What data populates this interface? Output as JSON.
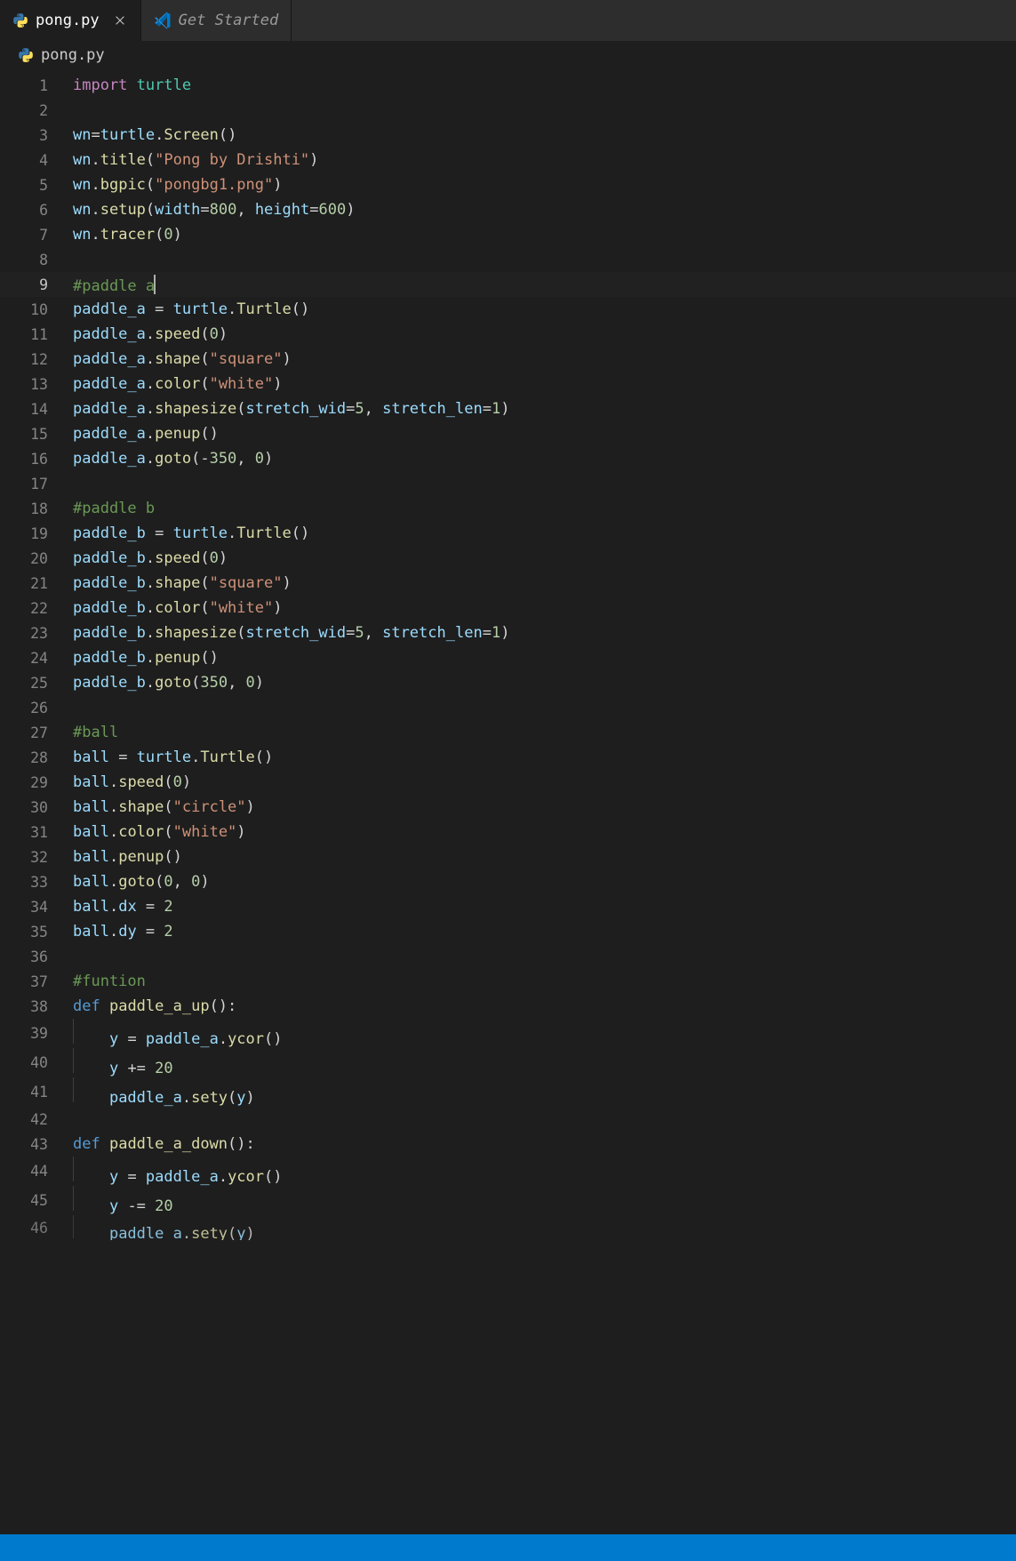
{
  "tabs": [
    {
      "icon": "python",
      "label": "pong.py",
      "active": true,
      "closeable": true
    },
    {
      "icon": "vscode",
      "label": "Get Started",
      "active": false,
      "closeable": false,
      "italic": true
    }
  ],
  "breadcrumb": {
    "icon": "python",
    "label": "pong.py"
  },
  "current_line": 9,
  "code": {
    "1": [
      {
        "c": "kw",
        "t": "import"
      },
      {
        "c": "p",
        "t": " "
      },
      {
        "c": "cls",
        "t": "turtle"
      }
    ],
    "2": [],
    "3": [
      {
        "c": "id",
        "t": "wn"
      },
      {
        "c": "p",
        "t": "="
      },
      {
        "c": "id",
        "t": "turtle"
      },
      {
        "c": "p",
        "t": "."
      },
      {
        "c": "fn",
        "t": "Screen"
      },
      {
        "c": "p",
        "t": "()"
      }
    ],
    "4": [
      {
        "c": "id",
        "t": "wn"
      },
      {
        "c": "p",
        "t": "."
      },
      {
        "c": "fn",
        "t": "title"
      },
      {
        "c": "p",
        "t": "("
      },
      {
        "c": "str",
        "t": "\"Pong by Drishti\""
      },
      {
        "c": "p",
        "t": ")"
      }
    ],
    "5": [
      {
        "c": "id",
        "t": "wn"
      },
      {
        "c": "p",
        "t": "."
      },
      {
        "c": "fn",
        "t": "bgpic"
      },
      {
        "c": "p",
        "t": "("
      },
      {
        "c": "str",
        "t": "\"pongbg1.png\""
      },
      {
        "c": "p",
        "t": ")"
      }
    ],
    "6": [
      {
        "c": "id",
        "t": "wn"
      },
      {
        "c": "p",
        "t": "."
      },
      {
        "c": "fn",
        "t": "setup"
      },
      {
        "c": "p",
        "t": "("
      },
      {
        "c": "id",
        "t": "width"
      },
      {
        "c": "p",
        "t": "="
      },
      {
        "c": "num",
        "t": "800"
      },
      {
        "c": "p",
        "t": ", "
      },
      {
        "c": "id",
        "t": "height"
      },
      {
        "c": "p",
        "t": "="
      },
      {
        "c": "num",
        "t": "600"
      },
      {
        "c": "p",
        "t": ")"
      }
    ],
    "7": [
      {
        "c": "id",
        "t": "wn"
      },
      {
        "c": "p",
        "t": "."
      },
      {
        "c": "fn",
        "t": "tracer"
      },
      {
        "c": "p",
        "t": "("
      },
      {
        "c": "num",
        "t": "0"
      },
      {
        "c": "p",
        "t": ")"
      }
    ],
    "8": [],
    "9": [
      {
        "c": "cmt",
        "t": "#paddle a"
      }
    ],
    "10": [
      {
        "c": "id",
        "t": "paddle_a"
      },
      {
        "c": "p",
        "t": " = "
      },
      {
        "c": "id",
        "t": "turtle"
      },
      {
        "c": "p",
        "t": "."
      },
      {
        "c": "fn",
        "t": "Turtle"
      },
      {
        "c": "p",
        "t": "()"
      }
    ],
    "11": [
      {
        "c": "id",
        "t": "paddle_a"
      },
      {
        "c": "p",
        "t": "."
      },
      {
        "c": "fn",
        "t": "speed"
      },
      {
        "c": "p",
        "t": "("
      },
      {
        "c": "num",
        "t": "0"
      },
      {
        "c": "p",
        "t": ")"
      }
    ],
    "12": [
      {
        "c": "id",
        "t": "paddle_a"
      },
      {
        "c": "p",
        "t": "."
      },
      {
        "c": "fn",
        "t": "shape"
      },
      {
        "c": "p",
        "t": "("
      },
      {
        "c": "str",
        "t": "\"square\""
      },
      {
        "c": "p",
        "t": ")"
      }
    ],
    "13": [
      {
        "c": "id",
        "t": "paddle_a"
      },
      {
        "c": "p",
        "t": "."
      },
      {
        "c": "fn",
        "t": "color"
      },
      {
        "c": "p",
        "t": "("
      },
      {
        "c": "str",
        "t": "\"white\""
      },
      {
        "c": "p",
        "t": ")"
      }
    ],
    "14": [
      {
        "c": "id",
        "t": "paddle_a"
      },
      {
        "c": "p",
        "t": "."
      },
      {
        "c": "fn",
        "t": "shapesize"
      },
      {
        "c": "p",
        "t": "("
      },
      {
        "c": "id",
        "t": "stretch_wid"
      },
      {
        "c": "p",
        "t": "="
      },
      {
        "c": "num",
        "t": "5"
      },
      {
        "c": "p",
        "t": ", "
      },
      {
        "c": "id",
        "t": "stretch_len"
      },
      {
        "c": "p",
        "t": "="
      },
      {
        "c": "num",
        "t": "1"
      },
      {
        "c": "p",
        "t": ")"
      }
    ],
    "15": [
      {
        "c": "id",
        "t": "paddle_a"
      },
      {
        "c": "p",
        "t": "."
      },
      {
        "c": "fn",
        "t": "penup"
      },
      {
        "c": "p",
        "t": "()"
      }
    ],
    "16": [
      {
        "c": "id",
        "t": "paddle_a"
      },
      {
        "c": "p",
        "t": "."
      },
      {
        "c": "fn",
        "t": "goto"
      },
      {
        "c": "p",
        "t": "(-"
      },
      {
        "c": "num",
        "t": "350"
      },
      {
        "c": "p",
        "t": ", "
      },
      {
        "c": "num",
        "t": "0"
      },
      {
        "c": "p",
        "t": ")"
      }
    ],
    "17": [],
    "18": [
      {
        "c": "cmt",
        "t": "#paddle b"
      }
    ],
    "19": [
      {
        "c": "id",
        "t": "paddle_b"
      },
      {
        "c": "p",
        "t": " = "
      },
      {
        "c": "id",
        "t": "turtle"
      },
      {
        "c": "p",
        "t": "."
      },
      {
        "c": "fn",
        "t": "Turtle"
      },
      {
        "c": "p",
        "t": "()"
      }
    ],
    "20": [
      {
        "c": "id",
        "t": "paddle_b"
      },
      {
        "c": "p",
        "t": "."
      },
      {
        "c": "fn",
        "t": "speed"
      },
      {
        "c": "p",
        "t": "("
      },
      {
        "c": "num",
        "t": "0"
      },
      {
        "c": "p",
        "t": ")"
      }
    ],
    "21": [
      {
        "c": "id",
        "t": "paddle_b"
      },
      {
        "c": "p",
        "t": "."
      },
      {
        "c": "fn",
        "t": "shape"
      },
      {
        "c": "p",
        "t": "("
      },
      {
        "c": "str",
        "t": "\"square\""
      },
      {
        "c": "p",
        "t": ")"
      }
    ],
    "22": [
      {
        "c": "id",
        "t": "paddle_b"
      },
      {
        "c": "p",
        "t": "."
      },
      {
        "c": "fn",
        "t": "color"
      },
      {
        "c": "p",
        "t": "("
      },
      {
        "c": "str",
        "t": "\"white\""
      },
      {
        "c": "p",
        "t": ")"
      }
    ],
    "23": [
      {
        "c": "id",
        "t": "paddle_b"
      },
      {
        "c": "p",
        "t": "."
      },
      {
        "c": "fn",
        "t": "shapesize"
      },
      {
        "c": "p",
        "t": "("
      },
      {
        "c": "id",
        "t": "stretch_wid"
      },
      {
        "c": "p",
        "t": "="
      },
      {
        "c": "num",
        "t": "5"
      },
      {
        "c": "p",
        "t": ", "
      },
      {
        "c": "id",
        "t": "stretch_len"
      },
      {
        "c": "p",
        "t": "="
      },
      {
        "c": "num",
        "t": "1"
      },
      {
        "c": "p",
        "t": ")"
      }
    ],
    "24": [
      {
        "c": "id",
        "t": "paddle_b"
      },
      {
        "c": "p",
        "t": "."
      },
      {
        "c": "fn",
        "t": "penup"
      },
      {
        "c": "p",
        "t": "()"
      }
    ],
    "25": [
      {
        "c": "id",
        "t": "paddle_b"
      },
      {
        "c": "p",
        "t": "."
      },
      {
        "c": "fn",
        "t": "goto"
      },
      {
        "c": "p",
        "t": "("
      },
      {
        "c": "num",
        "t": "350"
      },
      {
        "c": "p",
        "t": ", "
      },
      {
        "c": "num",
        "t": "0"
      },
      {
        "c": "p",
        "t": ")"
      }
    ],
    "26": [],
    "27": [
      {
        "c": "cmt",
        "t": "#ball"
      }
    ],
    "28": [
      {
        "c": "id",
        "t": "ball"
      },
      {
        "c": "p",
        "t": " = "
      },
      {
        "c": "id",
        "t": "turtle"
      },
      {
        "c": "p",
        "t": "."
      },
      {
        "c": "fn",
        "t": "Turtle"
      },
      {
        "c": "p",
        "t": "()"
      }
    ],
    "29": [
      {
        "c": "id",
        "t": "ball"
      },
      {
        "c": "p",
        "t": "."
      },
      {
        "c": "fn",
        "t": "speed"
      },
      {
        "c": "p",
        "t": "("
      },
      {
        "c": "num",
        "t": "0"
      },
      {
        "c": "p",
        "t": ")"
      }
    ],
    "30": [
      {
        "c": "id",
        "t": "ball"
      },
      {
        "c": "p",
        "t": "."
      },
      {
        "c": "fn",
        "t": "shape"
      },
      {
        "c": "p",
        "t": "("
      },
      {
        "c": "str",
        "t": "\"circle\""
      },
      {
        "c": "p",
        "t": ")"
      }
    ],
    "31": [
      {
        "c": "id",
        "t": "ball"
      },
      {
        "c": "p",
        "t": "."
      },
      {
        "c": "fn",
        "t": "color"
      },
      {
        "c": "p",
        "t": "("
      },
      {
        "c": "str",
        "t": "\"white\""
      },
      {
        "c": "p",
        "t": ")"
      }
    ],
    "32": [
      {
        "c": "id",
        "t": "ball"
      },
      {
        "c": "p",
        "t": "."
      },
      {
        "c": "fn",
        "t": "penup"
      },
      {
        "c": "p",
        "t": "()"
      }
    ],
    "33": [
      {
        "c": "id",
        "t": "ball"
      },
      {
        "c": "p",
        "t": "."
      },
      {
        "c": "fn",
        "t": "goto"
      },
      {
        "c": "p",
        "t": "("
      },
      {
        "c": "num",
        "t": "0"
      },
      {
        "c": "p",
        "t": ", "
      },
      {
        "c": "num",
        "t": "0"
      },
      {
        "c": "p",
        "t": ")"
      }
    ],
    "34": [
      {
        "c": "id",
        "t": "ball"
      },
      {
        "c": "p",
        "t": "."
      },
      {
        "c": "id",
        "t": "dx"
      },
      {
        "c": "p",
        "t": " = "
      },
      {
        "c": "num",
        "t": "2"
      }
    ],
    "35": [
      {
        "c": "id",
        "t": "ball"
      },
      {
        "c": "p",
        "t": "."
      },
      {
        "c": "id",
        "t": "dy"
      },
      {
        "c": "p",
        "t": " = "
      },
      {
        "c": "num",
        "t": "2"
      }
    ],
    "36": [],
    "37": [
      {
        "c": "cmt",
        "t": "#funtion"
      }
    ],
    "38": [
      {
        "c": "def",
        "t": "def"
      },
      {
        "c": "p",
        "t": " "
      },
      {
        "c": "fn",
        "t": "paddle_a_up"
      },
      {
        "c": "p",
        "t": "():"
      }
    ],
    "39": [
      {
        "c": "guide"
      },
      {
        "c": "p",
        "t": "    "
      },
      {
        "c": "id",
        "t": "y"
      },
      {
        "c": "p",
        "t": " = "
      },
      {
        "c": "id",
        "t": "paddle_a"
      },
      {
        "c": "p",
        "t": "."
      },
      {
        "c": "fn",
        "t": "ycor"
      },
      {
        "c": "p",
        "t": "()"
      }
    ],
    "40": [
      {
        "c": "guide"
      },
      {
        "c": "p",
        "t": "    "
      },
      {
        "c": "id",
        "t": "y"
      },
      {
        "c": "p",
        "t": " += "
      },
      {
        "c": "num",
        "t": "20"
      }
    ],
    "41": [
      {
        "c": "guide"
      },
      {
        "c": "p",
        "t": "    "
      },
      {
        "c": "id",
        "t": "paddle_a"
      },
      {
        "c": "p",
        "t": "."
      },
      {
        "c": "fn",
        "t": "sety"
      },
      {
        "c": "p",
        "t": "("
      },
      {
        "c": "id",
        "t": "y"
      },
      {
        "c": "p",
        "t": ")"
      }
    ],
    "42": [],
    "43": [
      {
        "c": "def",
        "t": "def"
      },
      {
        "c": "p",
        "t": " "
      },
      {
        "c": "fn",
        "t": "paddle_a_down"
      },
      {
        "c": "p",
        "t": "():"
      }
    ],
    "44": [
      {
        "c": "guide"
      },
      {
        "c": "p",
        "t": "    "
      },
      {
        "c": "id",
        "t": "y"
      },
      {
        "c": "p",
        "t": " = "
      },
      {
        "c": "id",
        "t": "paddle_a"
      },
      {
        "c": "p",
        "t": "."
      },
      {
        "c": "fn",
        "t": "ycor"
      },
      {
        "c": "p",
        "t": "()"
      }
    ],
    "45": [
      {
        "c": "guide"
      },
      {
        "c": "p",
        "t": "    "
      },
      {
        "c": "id",
        "t": "y"
      },
      {
        "c": "p",
        "t": " -= "
      },
      {
        "c": "num",
        "t": "20"
      }
    ],
    "46": [
      {
        "c": "guide"
      },
      {
        "c": "p",
        "t": "    "
      },
      {
        "c": "id",
        "t": "paddle_a"
      },
      {
        "c": "p",
        "t": "."
      },
      {
        "c": "fn",
        "t": "sety"
      },
      {
        "c": "p",
        "t": "("
      },
      {
        "c": "id",
        "t": "y"
      },
      {
        "c": "p",
        "t": ")"
      }
    ]
  },
  "line_count": 46
}
